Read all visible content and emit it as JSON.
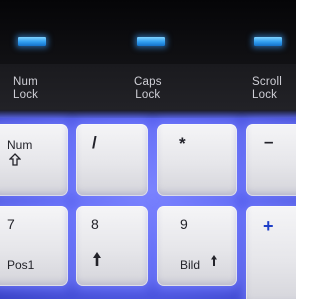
{
  "scene": {
    "led_color": "#3aa6ff",
    "glow_color": "#6b78ff",
    "key_color": "#ececf0"
  },
  "lock_labels": {
    "num_lock": [
      "Num",
      "Lock"
    ],
    "caps_lock": [
      "Caps",
      "Lock"
    ],
    "scroll_lock": [
      "Scroll",
      "Lock"
    ]
  },
  "keys": {
    "num": {
      "label": "Num",
      "icon": "shift-arrow-icon"
    },
    "divide": {
      "label": "/"
    },
    "multiply": {
      "label": "*"
    },
    "minus": {
      "label": "–"
    },
    "seven": {
      "label": "7",
      "sub": "Pos1"
    },
    "eight": {
      "label": "8",
      "icon": "arrow-up-icon"
    },
    "nine": {
      "label": "9",
      "sub": "Bild",
      "icon": "arrow-up-icon"
    },
    "plus": {
      "label": "+"
    }
  }
}
